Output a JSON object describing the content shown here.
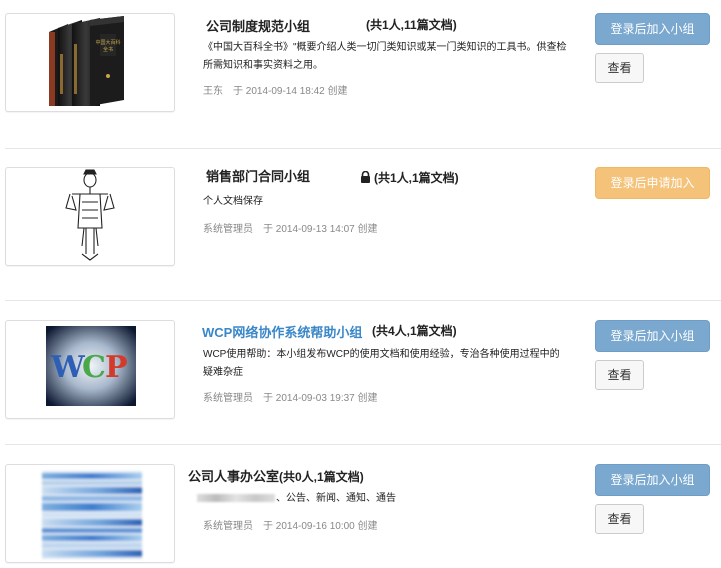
{
  "groups": [
    {
      "name": "公司制度规范小组",
      "stats": "(共1人,11篇文档)",
      "description": "《中国大百科全书》\"概要介绍人类一切门类知识或某一门类知识的工具书。供查检所需知识和事实资料之用。",
      "author": "王东",
      "created": "于 2014-09-14 18:42 创建",
      "join_label": "登录后加入小组",
      "view_label": "查看",
      "thumbnail": "encyclopedia-books-image"
    },
    {
      "name": "销售部门合同小组",
      "stats": "(共1人,1篇文档)",
      "description": "个人文档保存",
      "author": "系统管理员",
      "created": "于 2014-09-13 14:07 创建",
      "join_label": "登录后申请加入",
      "thumbnail": "sketch-figure-image",
      "locked": true
    },
    {
      "name": "WCP网络协作系统帮助小组",
      "stats": "(共4人,1篇文档)",
      "description": "WCP使用帮助：本小组发布WCP的使用文档和使用经验，专治各种使用过程中的疑难杂症",
      "author": "系统管理员",
      "created": "于 2014-09-03 19:37 创建",
      "join_label": "登录后加入小组",
      "view_label": "查看",
      "thumbnail": "wcp-logo-image"
    },
    {
      "name": "公司人事办公室",
      "stats": "(共0人,1篇文档)",
      "description": "、公告、新闻、通知、通告",
      "author": "系统管理员",
      "created": "于 2014-09-16 10:00 创建",
      "join_label": "登录后加入小组",
      "view_label": "查看",
      "thumbnail": "blurred-blue-image"
    }
  ],
  "colors": {
    "join_button": "#7aa8cf",
    "apply_button": "#f5c27a",
    "link_title": "#3a87c8"
  }
}
